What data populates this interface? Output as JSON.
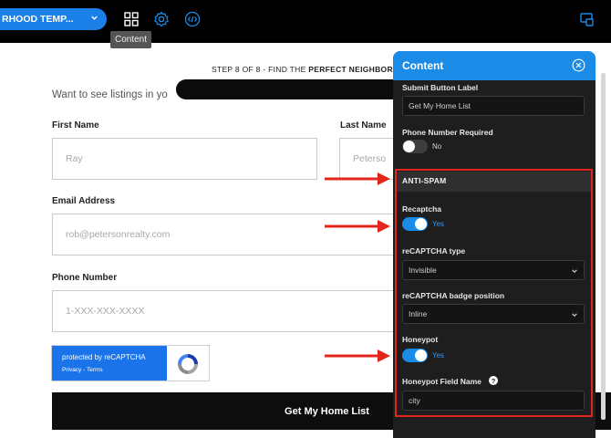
{
  "topbar": {
    "template_label": "RHOOD TEMP...",
    "tooltip": "Content"
  },
  "page": {
    "step_prefix": "STEP 8 OF 8 - FIND THE ",
    "step_bold": "PERFECT NEIGHBORH",
    "intro": "Want to see listings in yo",
    "first_name_label": "First Name",
    "first_name_value": "Ray",
    "last_name_label": "Last Name",
    "last_name_value": "Peterso",
    "email_label": "Email Address",
    "email_value": "rob@petersonrealty.com",
    "phone_label": "Phone Number",
    "phone_placeholder": "1-XXX-XXX-XXXX",
    "captcha_line1": "protected by reCAPTCHA",
    "captcha_line2": "Privacy - Terms",
    "submit_label": "Get My Home List"
  },
  "panel": {
    "title": "Content",
    "submit_button_label_label": "Submit Button Label",
    "submit_button_label_value": "Get My Home List",
    "phone_required_label": "Phone Number Required",
    "phone_required_state": "No",
    "section_title": "ANTI-SPAM",
    "recaptcha_label": "Recaptcha",
    "recaptcha_state": "Yes",
    "recaptcha_type_label": "reCAPTCHA type",
    "recaptcha_type_value": "Invisible",
    "badge_position_label": "reCAPTCHA badge position",
    "badge_position_value": "Inline",
    "honeypot_label": "Honeypot",
    "honeypot_state": "Yes",
    "honeypot_field_label": "Honeypot Field Name",
    "honeypot_help": "?",
    "honeypot_field_value": "city"
  },
  "colors": {
    "accent": "#1a8ce8",
    "annotation_red": "#e3261b",
    "panel_bg": "#1e1e1e"
  }
}
